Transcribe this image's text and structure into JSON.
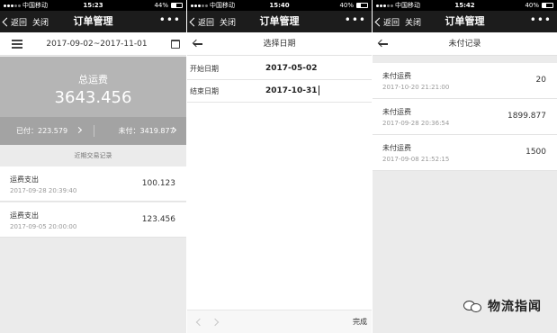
{
  "status_bar": {
    "carrier": "中国移动",
    "screens": [
      {
        "time": "15:23",
        "battery": "44%",
        "battery_level": 0.44
      },
      {
        "time": "15:40",
        "battery": "40%",
        "battery_level": 0.4
      },
      {
        "time": "15:42",
        "battery": "40%",
        "battery_level": 0.4
      }
    ]
  },
  "nav": {
    "back_label": "返回",
    "close_label": "关闭",
    "title": "订单管理",
    "more": "•••"
  },
  "summary_screen": {
    "date_range": "2017-09-02~2017-11-01",
    "total_label": "总运费",
    "total_value": "3643.456",
    "paid_text": "已付：223.579",
    "unpaid_text": "未付：3419.877",
    "section_title": "近期交易记录",
    "records": [
      {
        "name": "运费支出",
        "time": "2017-09-28 20:39:40",
        "amount": "100.123"
      },
      {
        "name": "运费支出",
        "time": "2017-09-05 20:00:00",
        "amount": "123.456"
      }
    ]
  },
  "date_screen": {
    "title": "选择日期",
    "start_label": "开始日期",
    "start_value": "2017-05-02",
    "end_label": "结束日期",
    "end_value": "2017-10-31",
    "done_label": "完成"
  },
  "unpaid_screen": {
    "title": "未付记录",
    "records": [
      {
        "name": "未付运费",
        "time": "2017-10-20 21:21:00",
        "amount": "20"
      },
      {
        "name": "未付运费",
        "time": "2017-09-28 20:36:54",
        "amount": "1899.877"
      },
      {
        "name": "未付运费",
        "time": "2017-09-08 21:52:15",
        "amount": "1500"
      }
    ]
  },
  "watermark": {
    "text": "物流指闻"
  }
}
